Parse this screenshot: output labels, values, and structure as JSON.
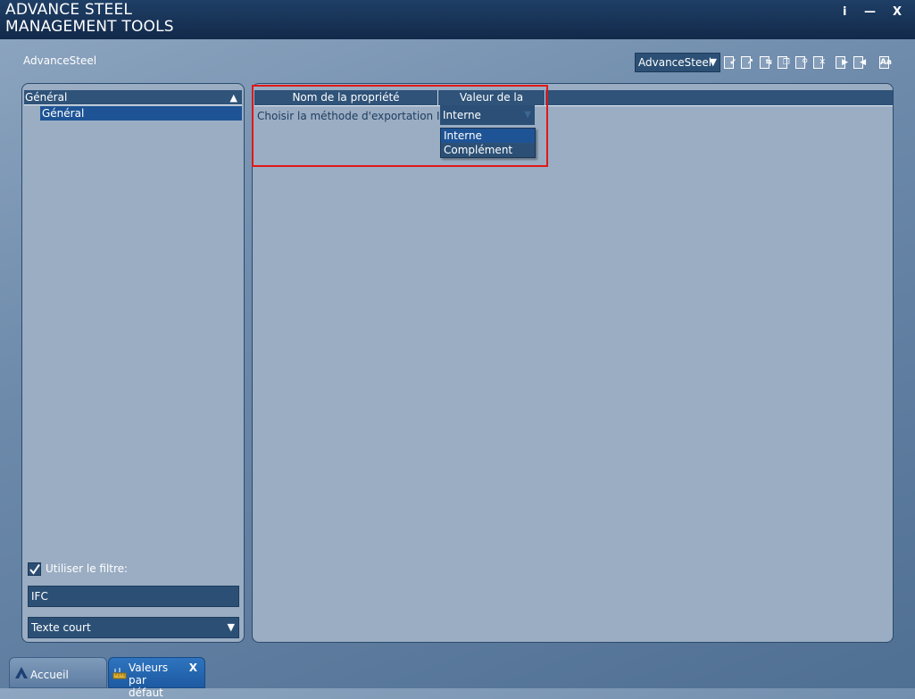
{
  "window": {
    "title": "ADVANCE STEEL\nMANAGEMENT TOOLS",
    "info_label": "i",
    "minimize_label": "—",
    "close_label": "X"
  },
  "context": {
    "label": "AdvanceSteel",
    "selected_profile": "AdvanceSteel"
  },
  "tree": {
    "root": "Général",
    "selected_child": "Général"
  },
  "filter": {
    "checkbox_label": "Utiliser le filtre:",
    "checked": true,
    "input_value": "IFC",
    "mode_value": "Texte court"
  },
  "grid": {
    "columns": [
      "Nom de la propriété",
      "Valeur de la propriété"
    ],
    "rows": [
      {
        "name": "Choisir la méthode d'exportation IFC",
        "value": "Interne"
      }
    ],
    "dropdown_options": [
      "Interne",
      "Complément"
    ],
    "dropdown_highlighted": "Interne"
  },
  "tabs": [
    {
      "label": "Accueil"
    },
    {
      "label": "Valeurs par\ndéfaut",
      "close": "X"
    }
  ],
  "colors": {
    "accent": "#1e5496",
    "highlight_box": "#e01818",
    "title_bar": "#12294a"
  }
}
